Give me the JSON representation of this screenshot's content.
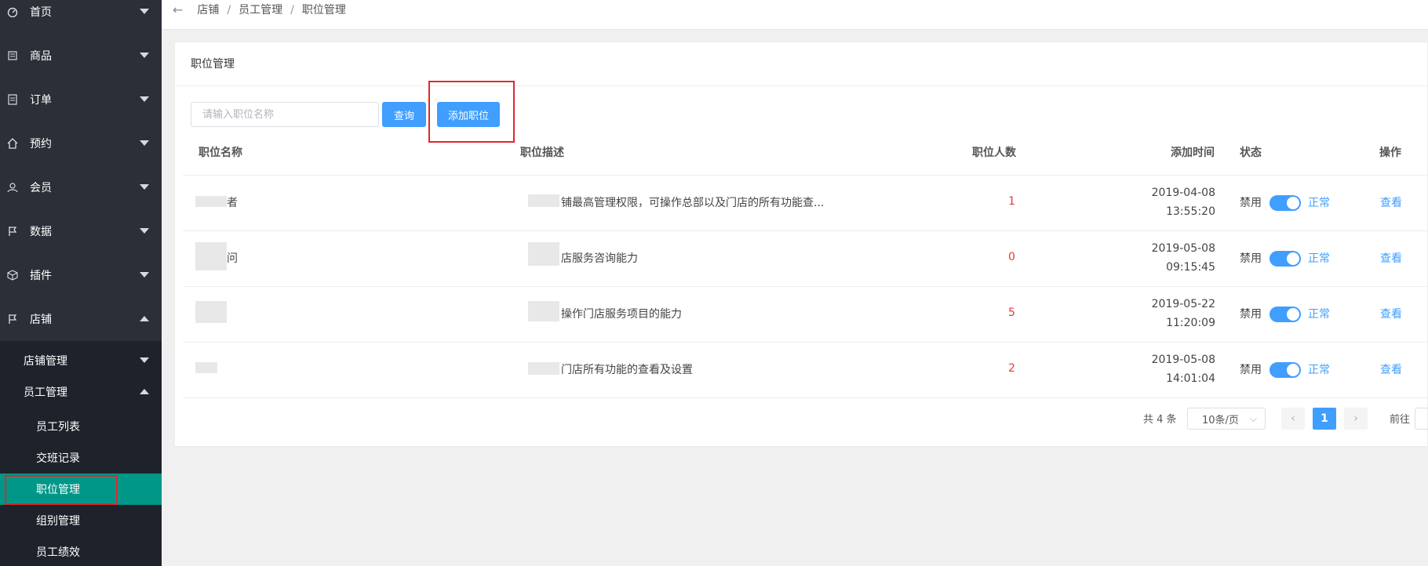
{
  "sidebar": {
    "items": [
      {
        "label": "首页",
        "icon": "dashboard-icon"
      },
      {
        "label": "商品",
        "icon": "goods-icon"
      },
      {
        "label": "订单",
        "icon": "order-icon"
      },
      {
        "label": "预约",
        "icon": "home-icon"
      },
      {
        "label": "会员",
        "icon": "user-icon"
      },
      {
        "label": "数据",
        "icon": "flag-icon"
      },
      {
        "label": "插件",
        "icon": "cube-icon"
      },
      {
        "label": "店铺",
        "icon": "flag-icon"
      }
    ],
    "sub_group": [
      {
        "label": "店铺管理"
      },
      {
        "label": "员工管理"
      }
    ],
    "sub_items": [
      {
        "label": "员工列表"
      },
      {
        "label": "交班记录"
      },
      {
        "label": "职位管理"
      },
      {
        "label": "组别管理"
      },
      {
        "label": "员工绩效"
      }
    ],
    "active_color": "#009688"
  },
  "breadcrumb": [
    "店铺",
    "员工管理",
    "职位管理"
  ],
  "card": {
    "title": "职位管理",
    "search_placeholder": "请输入职位名称",
    "query_label": "查询",
    "add_label": "添加职位"
  },
  "table": {
    "headers": [
      "职位名称",
      "职位描述",
      "职位人数",
      "添加时间",
      "状态",
      "操作"
    ],
    "rows": [
      {
        "name": "者",
        "desc": "铺最高管理权限，可操作总部以及门店的所有功能查...",
        "count": "1",
        "date": "2019-04-08",
        "time": "13:55:20",
        "disable": "禁用",
        "status": "正常",
        "action": "查看"
      },
      {
        "name": "问",
        "desc": "店服务咨询能力",
        "count": "0",
        "date": "2019-05-08",
        "time": "09:15:45",
        "disable": "禁用",
        "status": "正常",
        "action": "查看"
      },
      {
        "name": "",
        "desc": "操作门店服务项目的能力",
        "count": "5",
        "date": "2019-05-22",
        "time": "11:20:09",
        "disable": "禁用",
        "status": "正常",
        "action": "查看"
      },
      {
        "name": "",
        "desc": "门店所有功能的查看及设置",
        "count": "2",
        "date": "2019-05-08",
        "time": "14:01:04",
        "disable": "禁用",
        "status": "正常",
        "action": "查看"
      }
    ]
  },
  "pagination": {
    "total": "共 4 条",
    "page_size": "10条/页",
    "current": "1",
    "goto": "前往"
  },
  "colors": {
    "primary": "#409eff",
    "highlight": "#e4262c",
    "count": "#e4393c"
  }
}
